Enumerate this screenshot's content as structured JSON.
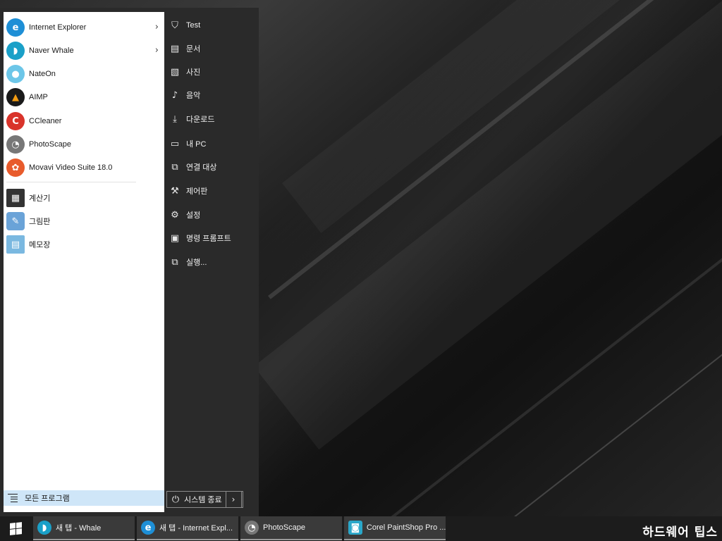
{
  "start_menu": {
    "apps": [
      {
        "label": "Internet Explorer",
        "icon": "internet-explorer-icon",
        "color": "#1e8fd6",
        "glyph": "e",
        "submenu": true
      },
      {
        "label": "Naver Whale",
        "icon": "naver-whale-icon",
        "color": "#1aa0c8",
        "glyph": "◗",
        "submenu": true
      },
      {
        "label": "NateOn",
        "icon": "nateon-icon",
        "color": "#6cc6e8",
        "glyph": "●",
        "submenu": false
      },
      {
        "label": "AIMP",
        "icon": "aimp-icon",
        "color": "#f39c12",
        "glyph": "▲",
        "submenu": false
      },
      {
        "label": "CCleaner",
        "icon": "ccleaner-icon",
        "color": "#d9342b",
        "glyph": "C",
        "submenu": false
      },
      {
        "label": "PhotoScape",
        "icon": "photoscape-icon",
        "color": "#666666",
        "glyph": "◔",
        "submenu": false
      },
      {
        "label": "Movavi Video Suite 18.0",
        "icon": "movavi-icon",
        "color": "#e85b2c",
        "glyph": "✿",
        "submenu": false
      },
      {
        "label": "계산기",
        "icon": "calculator-icon",
        "color": "#333333",
        "glyph": "▦",
        "submenu": false
      },
      {
        "label": "그림판",
        "icon": "paint-icon",
        "color": "#6aa3d8",
        "glyph": "✎",
        "submenu": false
      },
      {
        "label": "메모장",
        "icon": "notepad-icon",
        "color": "#7ab8e0",
        "glyph": "▤",
        "submenu": false
      }
    ],
    "all_programs_label": "모든 프로그램",
    "places": [
      {
        "label": "Test",
        "icon": "user-folder-icon",
        "glyph": "⛉"
      },
      {
        "label": "문서",
        "icon": "document-icon",
        "glyph": "▤"
      },
      {
        "label": "사진",
        "icon": "picture-icon",
        "glyph": "▧"
      },
      {
        "label": "음악",
        "icon": "music-icon",
        "glyph": "♪"
      },
      {
        "label": "다운로드",
        "icon": "download-icon",
        "glyph": "⤓"
      },
      {
        "label": "내 PC",
        "icon": "computer-icon",
        "glyph": "▭"
      },
      {
        "label": "연결 대상",
        "icon": "connect-icon",
        "glyph": "⧉"
      },
      {
        "label": "제어판",
        "icon": "wrench-icon",
        "glyph": "⚒"
      },
      {
        "label": "설정",
        "icon": "gear-icon",
        "glyph": "⚙"
      },
      {
        "label": "명령 프롬프트",
        "icon": "command-prompt-icon",
        "glyph": "▣"
      },
      {
        "label": "실행...",
        "icon": "run-icon",
        "glyph": "⧉"
      }
    ],
    "shutdown_label": "시스템 종료",
    "shutdown_arrow": "›"
  },
  "taskbar": {
    "items": [
      {
        "label": "새 탭 - Whale",
        "icon": "naver-whale-icon",
        "color": "#1aa0c8",
        "glyph": "◗"
      },
      {
        "label": "새 탭 - Internet Expl...",
        "icon": "internet-explorer-icon",
        "color": "#1e8fd6",
        "glyph": "e"
      },
      {
        "label": "PhotoScape",
        "icon": "photoscape-icon",
        "color": "#666666",
        "glyph": "◔"
      },
      {
        "label": "Corel PaintShop Pro ...",
        "icon": "paintshop-camera-icon",
        "color": "#2aa7c9",
        "glyph": "◙"
      }
    ],
    "watermark": "하드웨어 팁스"
  }
}
